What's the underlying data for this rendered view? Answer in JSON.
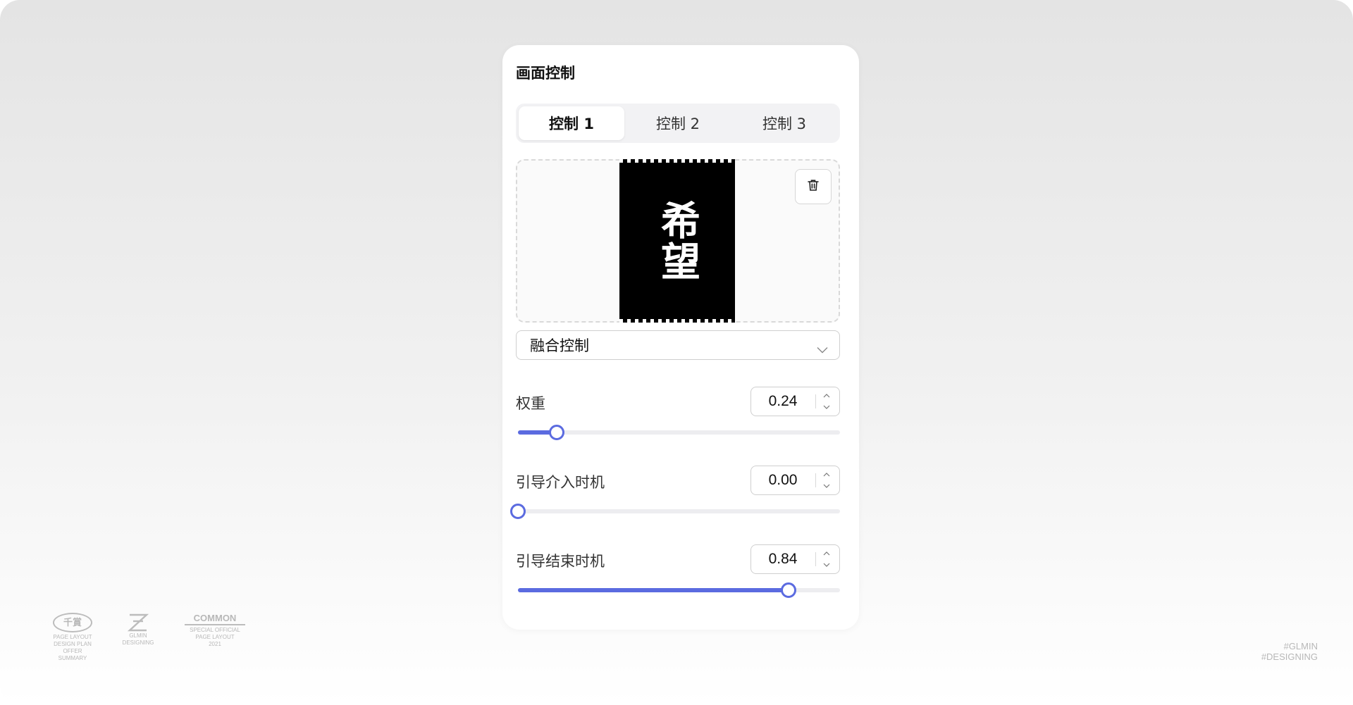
{
  "panel": {
    "title": "画面控制"
  },
  "tabs": [
    {
      "label": "控制 1",
      "active": true
    },
    {
      "label": "控制 2",
      "active": false
    },
    {
      "label": "控制 3",
      "active": false
    }
  ],
  "preview": {
    "image_text": "希望",
    "delete_icon": "trash-icon"
  },
  "mode_select": {
    "selected": "融合控制",
    "icon": "chevron-down-icon"
  },
  "params": [
    {
      "label": "权重",
      "value": "0.24",
      "fraction": 0.12
    },
    {
      "label": "引导介入时机",
      "value": "0.00",
      "fraction": 0.0
    },
    {
      "label": "引导结束时机",
      "value": "0.84",
      "fraction": 0.84
    }
  ],
  "accent_color": "#5b6be0",
  "footer": {
    "logos": [
      {
        "main": "千賞",
        "sub": [
          "PAGE LAYOUT",
          "DESIGN PLAN",
          "OFFER SUMMARY"
        ]
      },
      {
        "main": "GLMIN",
        "sub": [
          "GLMIN",
          "DESIGNING"
        ]
      },
      {
        "main": "COMMON",
        "sub": [
          "SPECIAL OFFICIAL",
          "PAGE LAYOUT",
          "2021"
        ]
      }
    ],
    "watermark": [
      "#GLMIN",
      "#DESIGNING"
    ]
  }
}
